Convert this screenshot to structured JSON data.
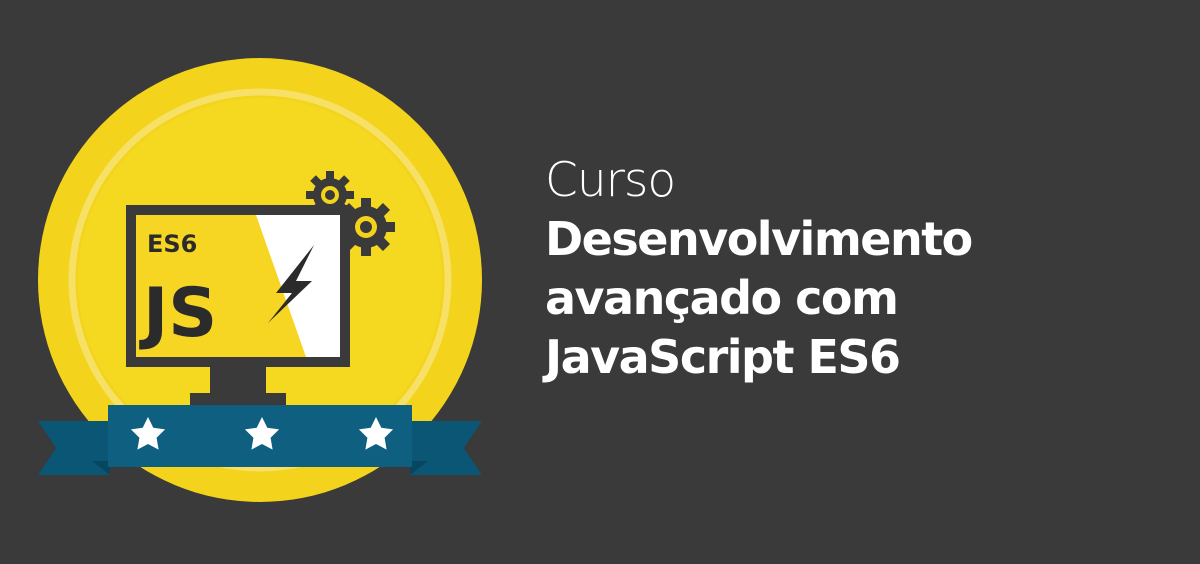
{
  "badge": {
    "screen_tag": "ES6",
    "screen_logo": "JS",
    "stars": 3,
    "colors": {
      "gold": "#f3d31b",
      "gold_ring": "#f7e066",
      "ribbon": "#0e5f80",
      "ribbon_dark": "#08465f",
      "monitor_frame": "#3a3a3a",
      "screen_yellow": "#f6d623"
    }
  },
  "heading": {
    "kicker": "Curso",
    "lines": [
      "Desenvolvimento",
      "avançado com",
      "JavaScript ES6"
    ]
  },
  "colors": {
    "background": "#3a3a3a",
    "text": "#ffffff"
  }
}
